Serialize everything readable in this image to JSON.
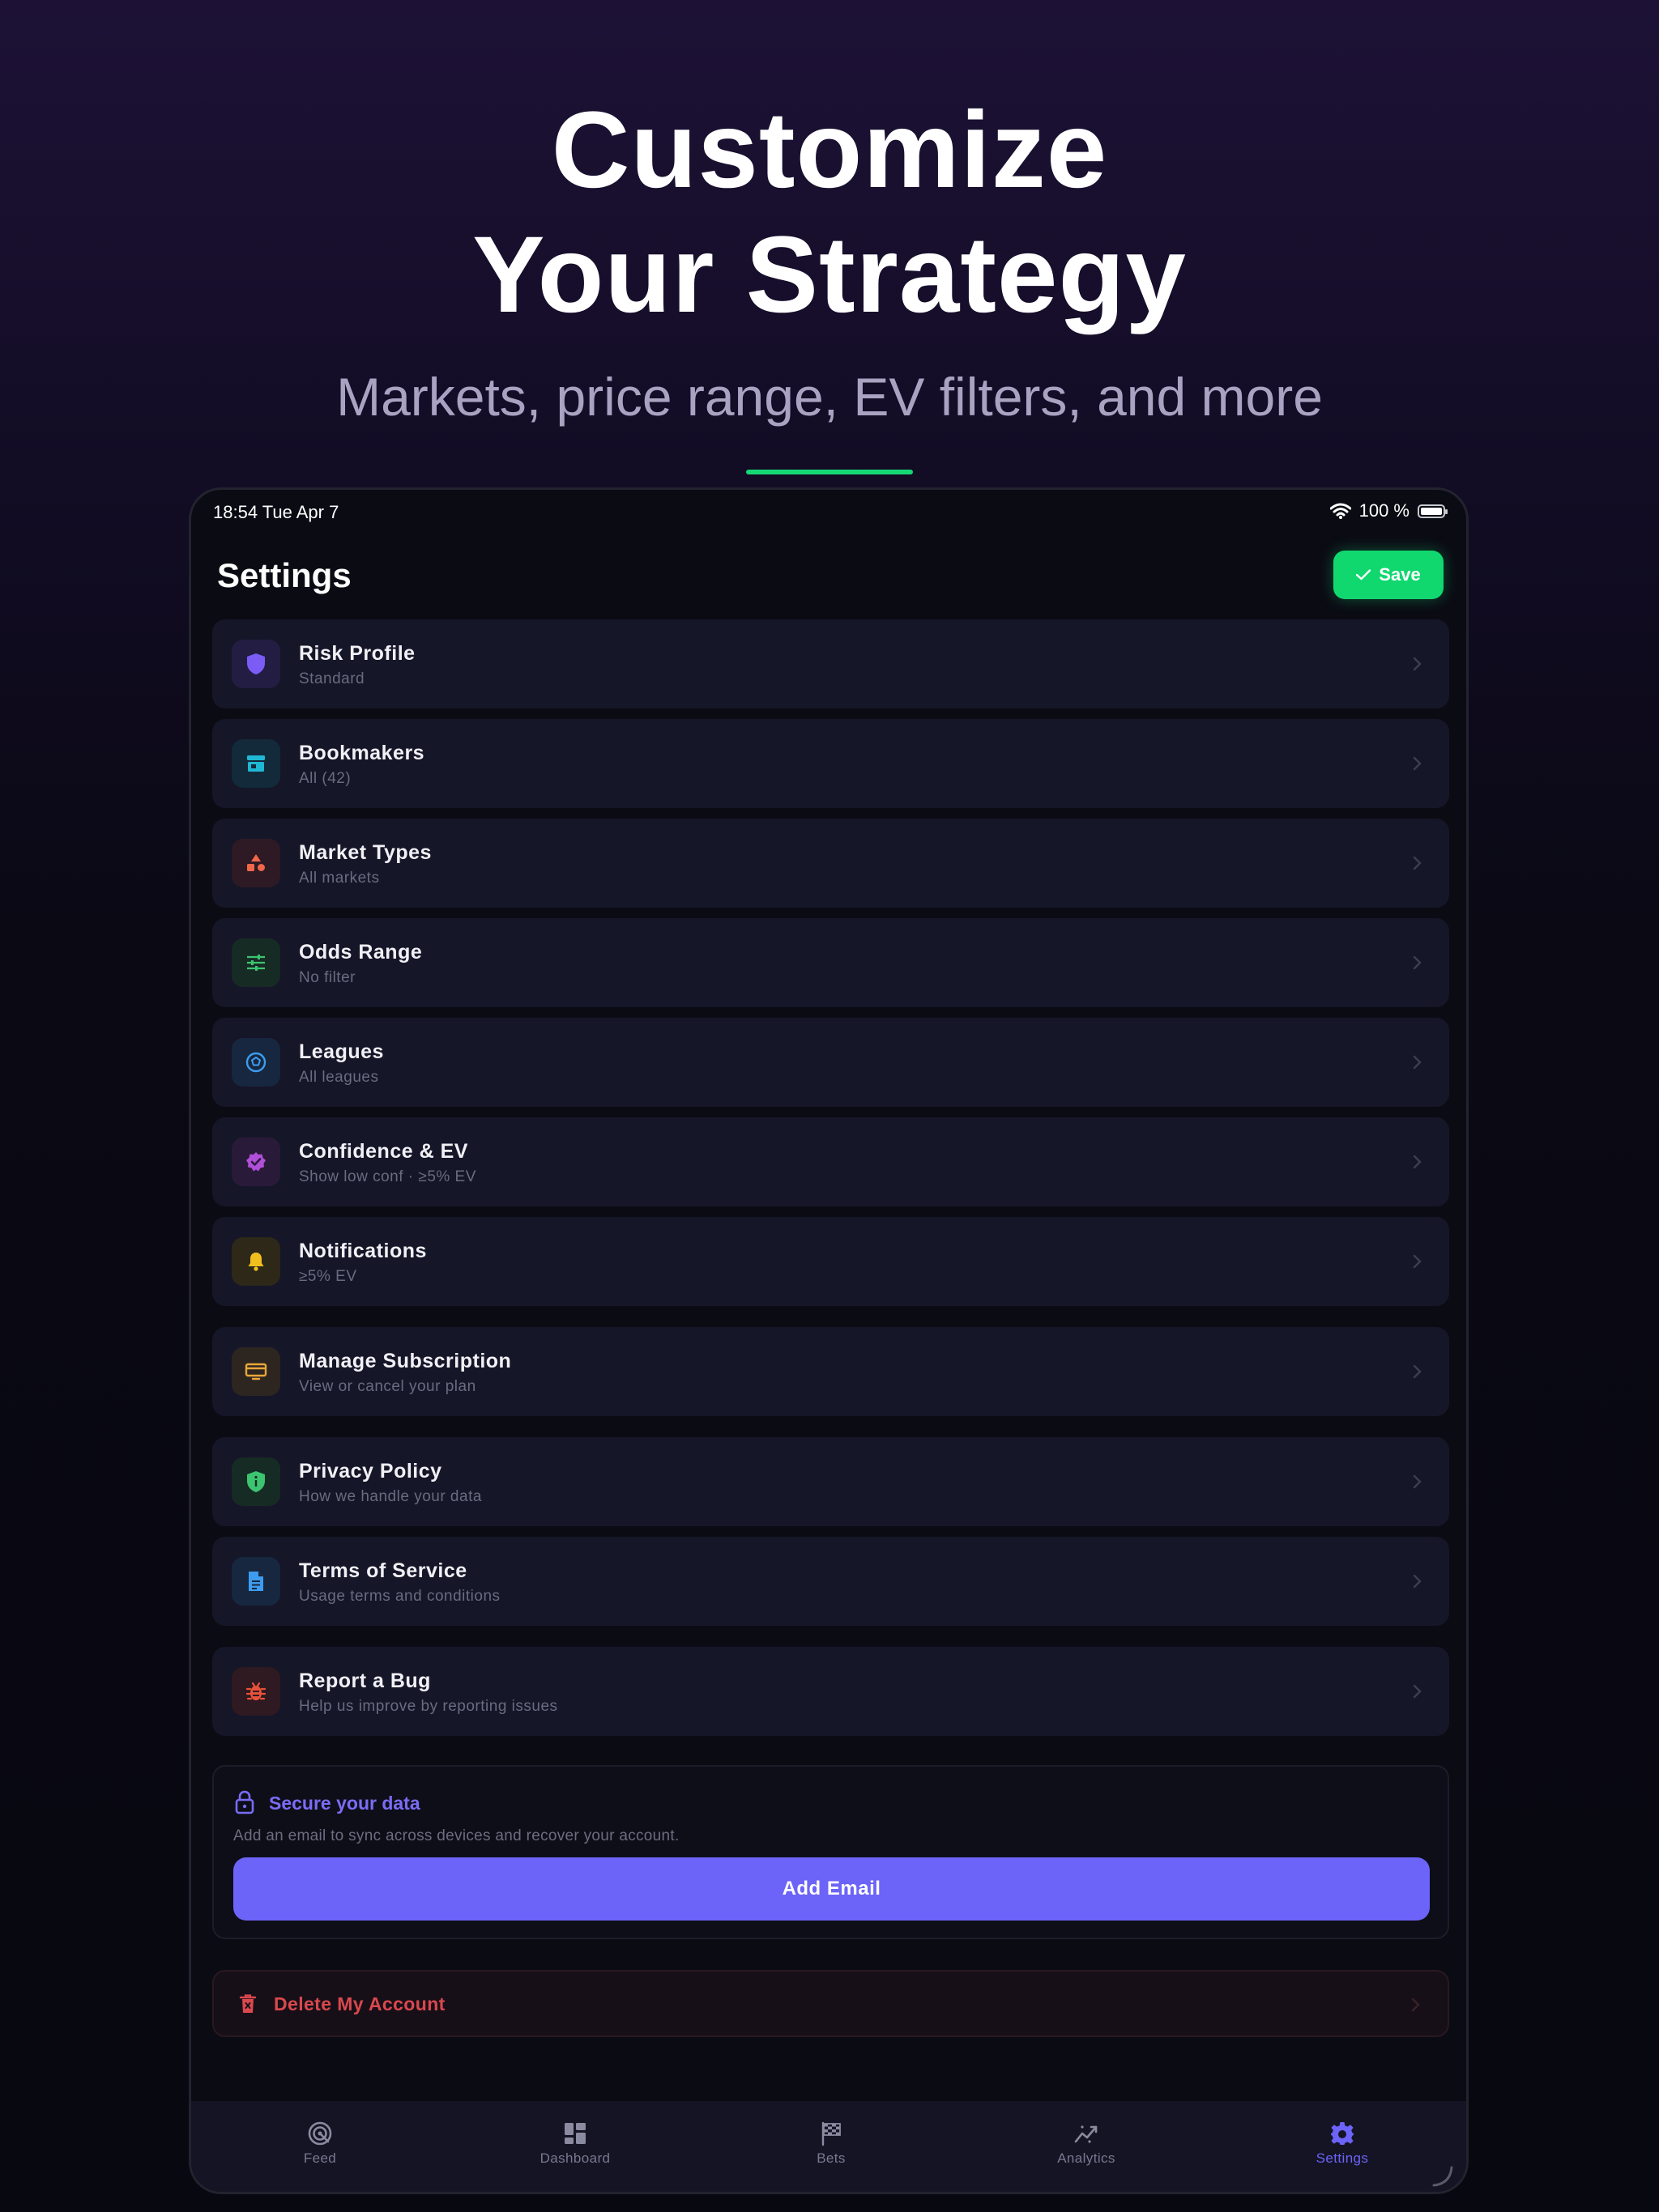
{
  "hero": {
    "title_line1": "Customize",
    "title_line2": "Your Strategy",
    "subtitle": "Markets, price range, EV filters, and more"
  },
  "status_bar": {
    "time": "18:54   Tue Apr 7",
    "battery": "100 %"
  },
  "header": {
    "title": "Settings",
    "save_label": "Save"
  },
  "settings_items": [
    {
      "label": "Risk Profile",
      "sub": "Standard",
      "icon": "shield-icon",
      "color": "#7b5cf5"
    },
    {
      "label": "Bookmakers",
      "sub": "All (42)",
      "icon": "store-icon",
      "color": "#1fb8d4"
    },
    {
      "label": "Market Types",
      "sub": "All markets",
      "icon": "shapes-icon",
      "color": "#f0674a"
    },
    {
      "label": "Odds Range",
      "sub": "No filter",
      "icon": "sliders-icon",
      "color": "#3cc470"
    },
    {
      "label": "Leagues",
      "sub": "All leagues",
      "icon": "ball-icon",
      "color": "#3d9cf0"
    },
    {
      "label": "Confidence & EV",
      "sub": "Show low conf · ≥5% EV",
      "icon": "verified-badge-icon",
      "color": "#b04fd8"
    },
    {
      "label": "Notifications",
      "sub": "≥5% EV",
      "icon": "bell-icon",
      "color": "#f0bf1f"
    },
    {
      "label": "Manage Subscription",
      "sub": "View or cancel your plan",
      "icon": "card-icon",
      "color": "#e8a73a"
    },
    {
      "label": "Privacy Policy",
      "sub": "How we handle your data",
      "icon": "privacy-shield-icon",
      "color": "#3cc470"
    },
    {
      "label": "Terms of Service",
      "sub": "Usage terms and conditions",
      "icon": "document-icon",
      "color": "#3d9cf0"
    },
    {
      "label": "Report a Bug",
      "sub": "Help us improve by reporting issues",
      "icon": "bug-icon",
      "color": "#e8523a"
    }
  ],
  "secure": {
    "title": "Secure your data",
    "description": "Add an email to sync across devices and recover your account.",
    "button_label": "Add Email"
  },
  "delete": {
    "label": "Delete My Account"
  },
  "tabs": [
    {
      "label": "Feed",
      "icon": "feed-icon"
    },
    {
      "label": "Dashboard",
      "icon": "dashboard-icon"
    },
    {
      "label": "Bets",
      "icon": "flag-icon"
    },
    {
      "label": "Analytics",
      "icon": "analytics-icon"
    },
    {
      "label": "Settings",
      "icon": "gear-icon",
      "active": true
    }
  ],
  "colors": {
    "accent_green": "#10d86f",
    "accent_purple": "#6c63f8",
    "danger": "#d9484e"
  }
}
